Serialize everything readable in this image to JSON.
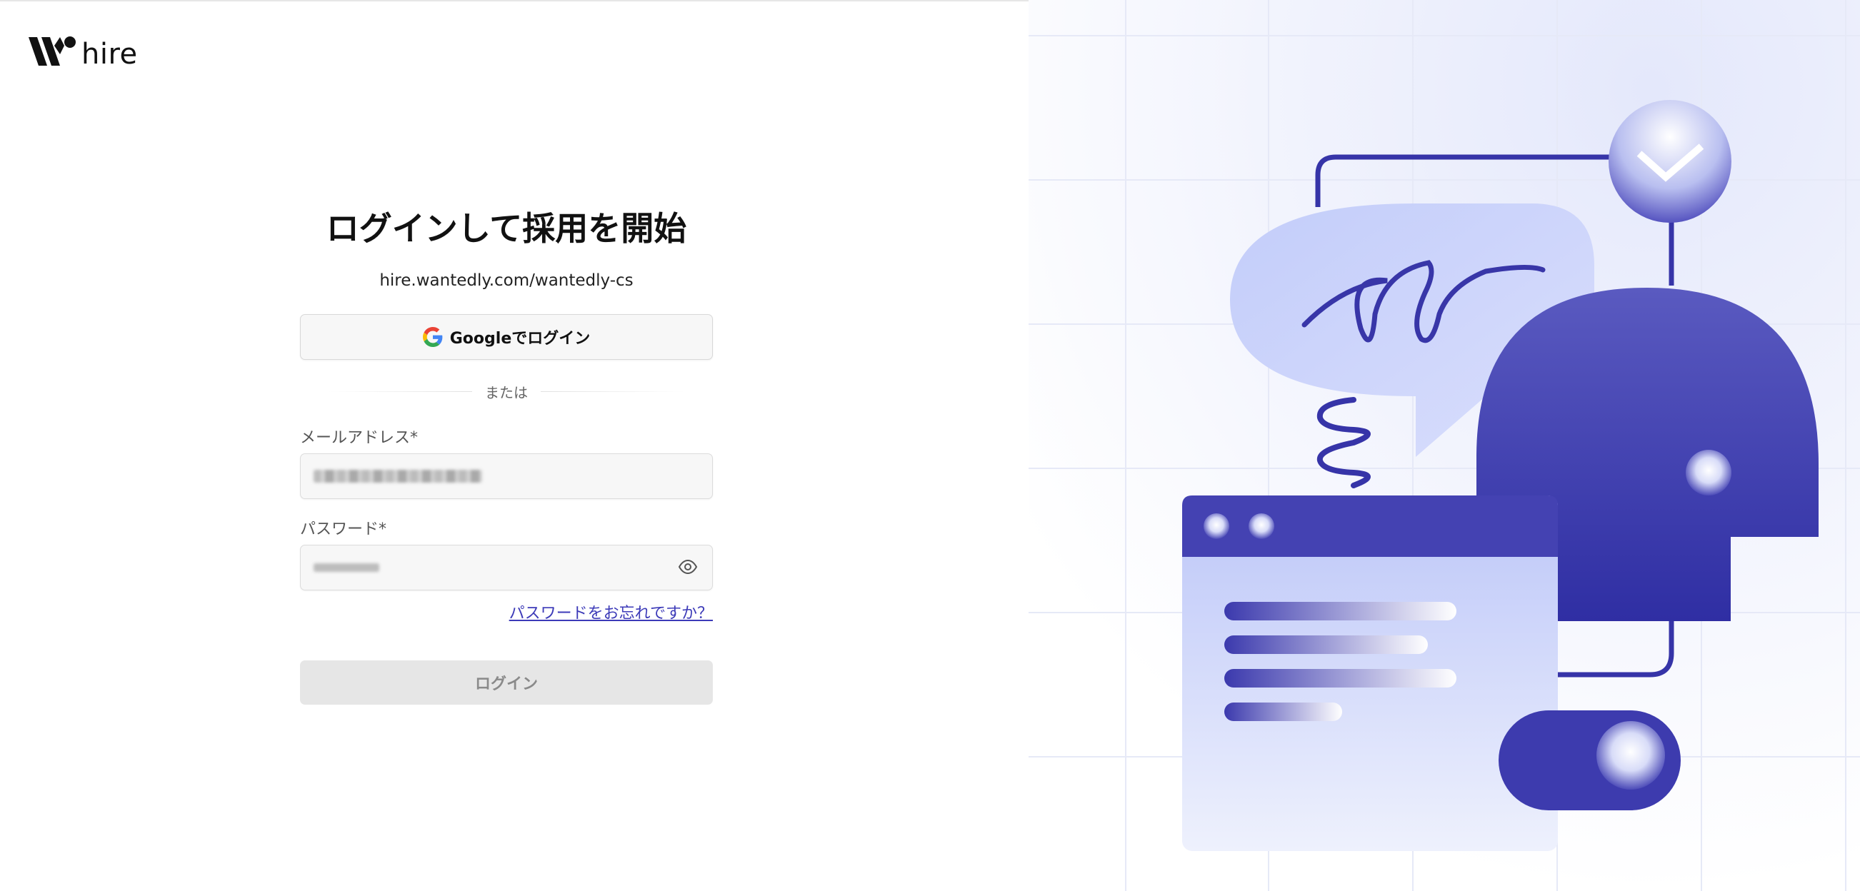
{
  "logo": {
    "text": "hire"
  },
  "login": {
    "title": "ログインして採用を開始",
    "subdomain": "hire.wantedly.com/wantedly-cs",
    "google_button": "Googleでログイン",
    "divider_text": "または",
    "email_label": "メールアドレス*",
    "password_label": "パスワード*",
    "forgot_link": "パスワードをお忘れですか？",
    "submit_button": "ログイン"
  },
  "colors": {
    "accent": "#3c3ab8",
    "illustration_primary": "#3836a8",
    "illustration_light": "#c7d0fb",
    "button_disabled": "#e6e6e6"
  },
  "icons": [
    "wantedly-logo-icon",
    "google-icon",
    "eye-icon"
  ]
}
